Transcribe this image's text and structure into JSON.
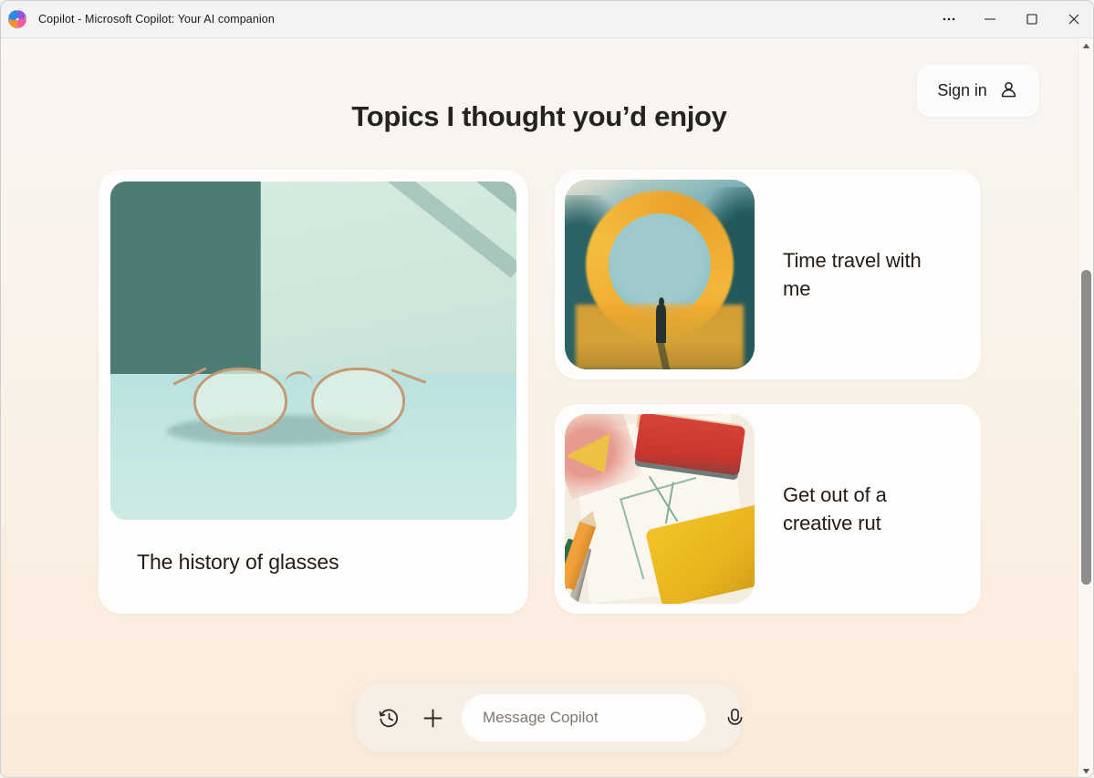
{
  "window": {
    "app_icon": "copilot-logo-icon",
    "title": "Copilot - Microsoft Copilot: Your AI companion",
    "controls": {
      "more": "…",
      "more_name": "more-options-icon",
      "minimize": "minimize-icon",
      "maximize": "maximize-icon",
      "close": "close-icon"
    }
  },
  "header": {
    "signin_label": "Sign in",
    "signin_icon": "person-icon",
    "page_title": "Topics I thought you’d enjoy"
  },
  "cards": [
    {
      "id": "history-of-glasses",
      "title": "The history of glasses",
      "image_alt": "Illustration of round eyeglasses resting on a sunlit pale blue table with a green wall behind",
      "layout": "large"
    },
    {
      "id": "time-travel-with-me",
      "title": "Time travel with me",
      "image_alt": "Illustration of a silhouetted figure standing before a glowing yellow-orange ring portal with a teal centre",
      "layout": "wide"
    },
    {
      "id": "get-out-of-a-creative-rut",
      "title": "Get out of a creative rut",
      "image_alt": "Illustration of art supplies: a red eraser, yellow block, coloured pencils and a sketch on paper",
      "layout": "wide"
    }
  ],
  "composer": {
    "history_icon": "history-clock-icon",
    "add_icon": "plus-icon",
    "input_placeholder": "Message Copilot",
    "input_value": "",
    "mic_icon": "microphone-icon"
  },
  "scrollbar": {
    "up_icon": "chevron-up-icon",
    "down_icon": "chevron-down-icon"
  },
  "colors": {
    "background_top": "#f8f5f2",
    "background_bottom": "#faecdc",
    "card_surface": "#fffdfb",
    "composer_surface": "#f7efe6",
    "text_primary": "#1f1c1a",
    "titlebar": "#f3f3f3"
  }
}
